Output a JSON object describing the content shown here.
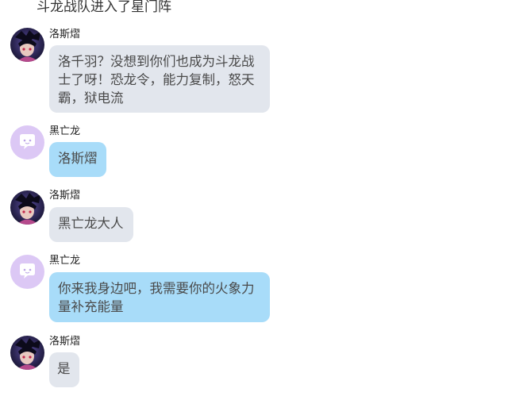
{
  "header": {
    "text": "斗龙战队进入了星门阵"
  },
  "messages": [
    {
      "sender": "洛斯熠",
      "avatar": "dark-hero-avatar-icon",
      "bubble_color": "#e2e6ed",
      "text": "洛千羽？没想到你们也成为斗龙战士了呀！恐龙令，能力复制，怒天霸，狱电流"
    },
    {
      "sender": "黑亡龙",
      "avatar": "chat-bubble-avatar-icon",
      "bubble_color": "#a8dcf9",
      "text": "洛斯熠"
    },
    {
      "sender": "洛斯熠",
      "avatar": "dark-hero-avatar-icon",
      "bubble_color": "#e2e6ed",
      "text": "黑亡龙大人"
    },
    {
      "sender": "黑亡龙",
      "avatar": "chat-bubble-avatar-icon",
      "bubble_color": "#a8dcf9",
      "text": "你来我身边吧，我需要你的火象力量补充能量"
    },
    {
      "sender": "洛斯熠",
      "avatar": "dark-hero-avatar-icon",
      "bubble_color": "#e2e6ed",
      "text": "是"
    }
  ],
  "colors": {
    "grey_bubble": "#e2e6ed",
    "blue_bubble": "#a8dcf9",
    "lilac_avatar": "#dcc8f5"
  }
}
